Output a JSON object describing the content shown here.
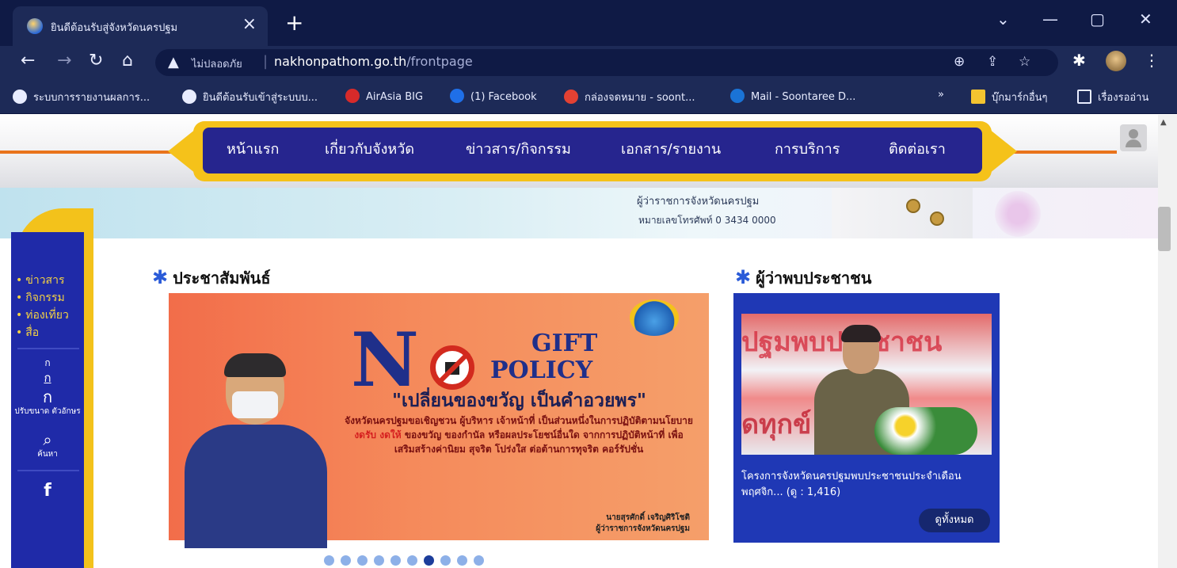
{
  "browser": {
    "tab_title": "ยินดีต้อนรับสู่จังหวัดนครปฐม",
    "tab_close": "×",
    "new_tab": "+",
    "window_controls": {
      "minimize_glyph": "—",
      "restore_glyph": "▢",
      "close_glyph": "✕",
      "dropdown_glyph": "⌄"
    },
    "address": {
      "security_label": "ไม่ปลอดภัย",
      "separator": "|",
      "host": "nakhonpathom.go.th",
      "path": "/frontpage"
    },
    "bookmarks": [
      {
        "label": "ระบบการรายงานผลการ...",
        "icon": "globe-icon",
        "color": "#e8ecff"
      },
      {
        "label": "ยินดีต้อนรับเข้าสู่ระบบบ...",
        "icon": "globe-icon",
        "color": "#e8ecff"
      },
      {
        "label": "AirAsia BIG",
        "icon": "big-icon",
        "color": "#d72a2a"
      },
      {
        "label": "(1) Facebook",
        "icon": "facebook-icon",
        "color": "#1f6fe8"
      },
      {
        "label": "กล่องจดหมาย - soont...",
        "icon": "gmail-icon",
        "color": "#e34133"
      },
      {
        "label": "Mail - Soontaree D...",
        "icon": "outlook-icon",
        "color": "#1a73d6"
      }
    ],
    "bookmarks_overflow": "»",
    "other_bookmarks": "บุ๊กมาร์กอื่นๆ",
    "reading_list": "เรื่องรออ่าน"
  },
  "site": {
    "nav": [
      "หน้าแรก",
      "เกี่ยวกับจังหวัด",
      "ข่าวสาร/กิจกรรม",
      "เอกสาร/รายงาน",
      "การบริการ",
      "ติดต่อเรา"
    ],
    "banner": {
      "governor_line": "ผู้ว่าราชการจังหวัดนครปฐม",
      "phone_line": "หมายเลขโทรศัพท์ 0 3434 0000"
    },
    "sidebar": {
      "links": [
        "ข่าวสาร",
        "กิจกรรม",
        "ท่องเที่ยว",
        "สื่อ"
      ],
      "font_small": "ก",
      "font_medium": "ก",
      "font_large": "ก",
      "font_label": "ปรับขนาด ตัวอักษร",
      "search_label": "ค้นหา",
      "facebook_glyph": "f"
    },
    "pr_section": {
      "title": "ประชาสัมพันธ์",
      "slide": {
        "big_letter": "N",
        "gift_line1": "GIFT",
        "gift_line2": "POLICY",
        "quote": "\"เปลี่ยนของขวัญ เป็นคำอวยพร\"",
        "desc_a": "จังหวัดนครปฐมขอเชิญชวน ผู้บริหาร เจ้าหน้าที่ เป็นส่วนหนึ่งในการปฏิบัติตามนโยบาย ",
        "desc_red": "งดรับ งดให้",
        "desc_b": " ของขวัญ ของกำนัล หรือผลประโยชน์อื่นใด จากการปฏิบัติหน้าที่ เพื่อเสริมสร้างค่านิยม สุจริต โปร่งใส ต่อต้านการทุจริต คอร์รัปชั่น",
        "signer_name": "นายสุรศักดิ์ เจริญศิริโชติ",
        "signer_title": "ผู้ว่าราชการจังหวัดนครปฐม"
      },
      "dot_count": 10,
      "active_dot": 7
    },
    "governor_section": {
      "title": "ผู้ว่าพบประชาชน",
      "photo_text1": "ปฐมพบประชาชน",
      "photo_text2": "ดทุกข์",
      "caption": "โครงการจังหวัดนครปฐมพบประชาชนประจำเดือนพฤศจิก... (ดู : 1,416)",
      "view_all": "ดูทั้งหมด"
    },
    "colors": {
      "nav_blue": "#26258e",
      "gold": "#f5c21a",
      "accent_orange": "#e9731c"
    }
  }
}
